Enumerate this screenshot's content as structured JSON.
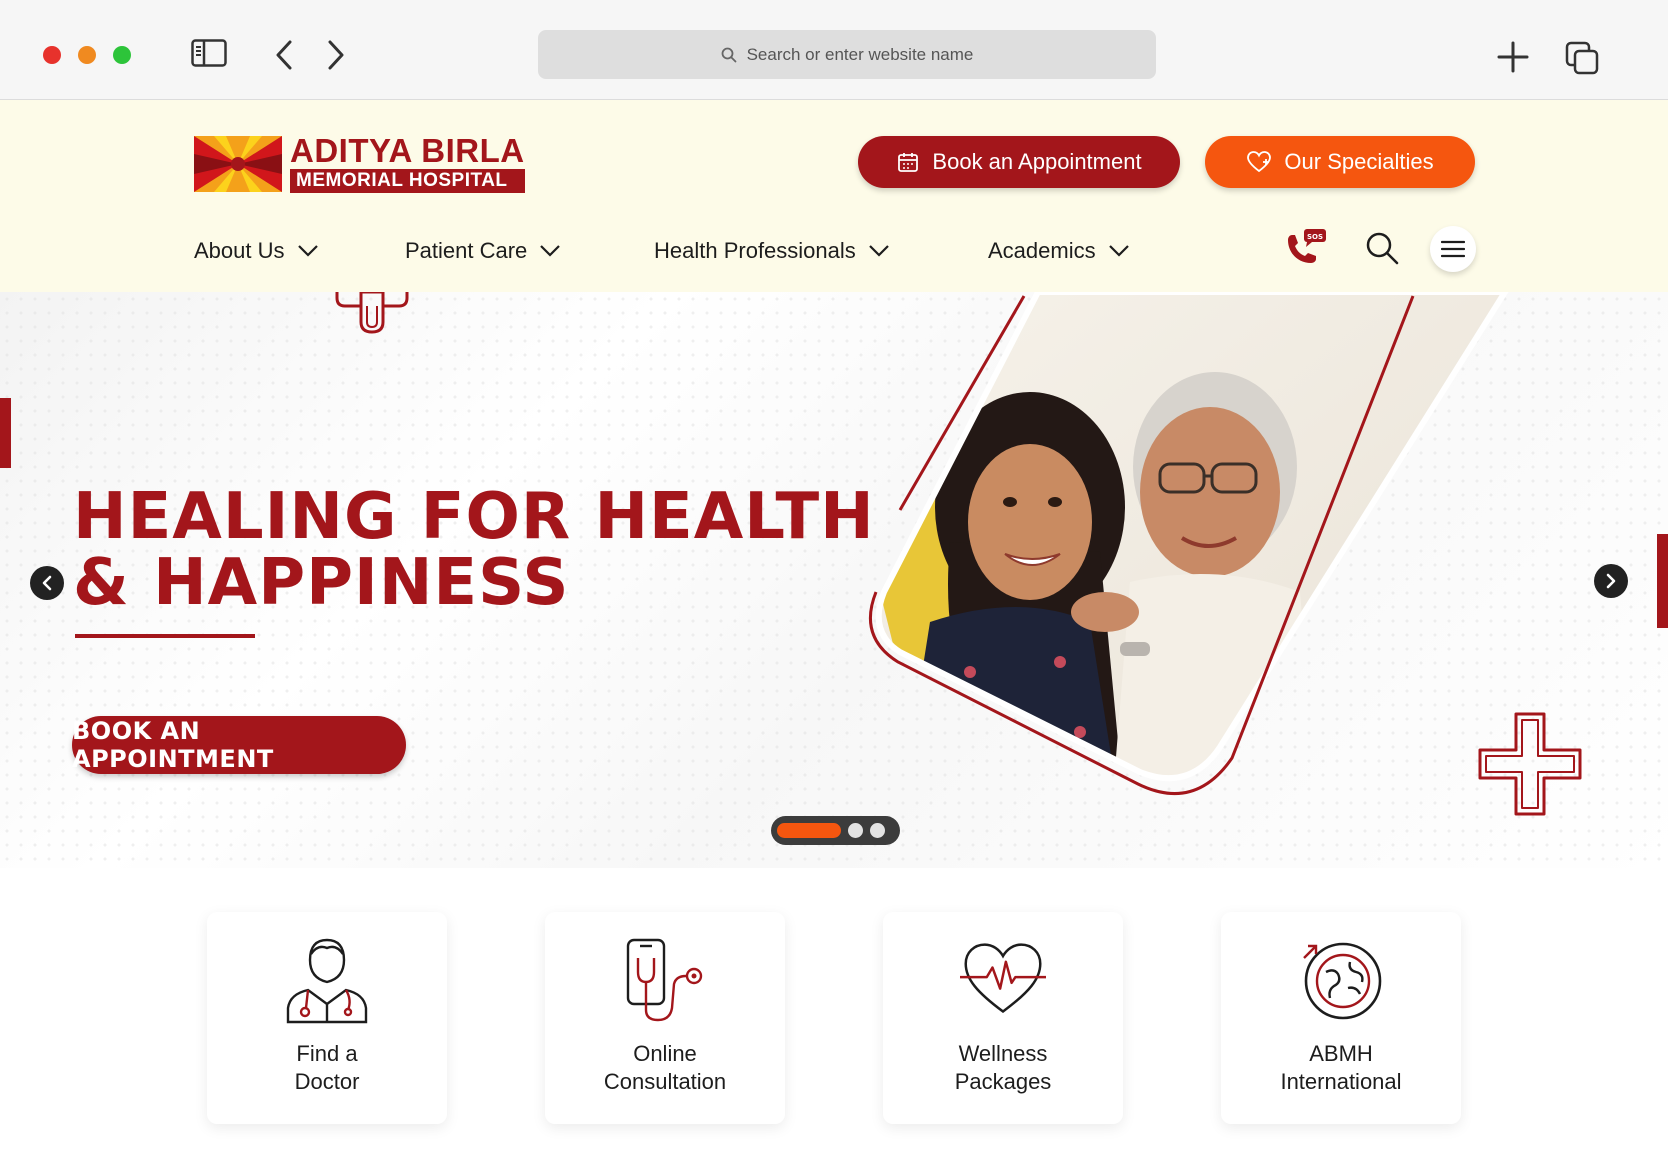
{
  "browser": {
    "url_placeholder": "Search or enter website name"
  },
  "header": {
    "logo_line1": "ADITYA BIRLA",
    "logo_line2": "MEMORIAL HOSPITAL",
    "book_appointment_label": "Book an Appointment",
    "our_specialties_label": "Our Specialties",
    "sos_badge": "SOS",
    "nav": [
      {
        "label": "About Us"
      },
      {
        "label": "Patient Care"
      },
      {
        "label": "Health Professionals"
      },
      {
        "label": "Academics"
      }
    ]
  },
  "hero": {
    "title_line1": "HEALING FOR HEALTH",
    "title_line2": "& HAPPINESS",
    "cta_label": "BOOK AN APPOINTMENT",
    "slides_total": 3,
    "active_slide": 1
  },
  "quick_links": [
    {
      "line1": "Find a",
      "line2": "Doctor",
      "icon": "doctor-icon"
    },
    {
      "line1": "Online",
      "line2": "Consultation",
      "icon": "phone-stethoscope-icon"
    },
    {
      "line1": "Wellness",
      "line2": "Packages",
      "icon": "heart-pulse-icon"
    },
    {
      "line1": "ABMH",
      "line2": "International",
      "icon": "globe-icon"
    }
  ],
  "colors": {
    "brand_red": "#a3161b",
    "brand_orange": "#f5560f",
    "header_bg": "#fdfbe8"
  }
}
